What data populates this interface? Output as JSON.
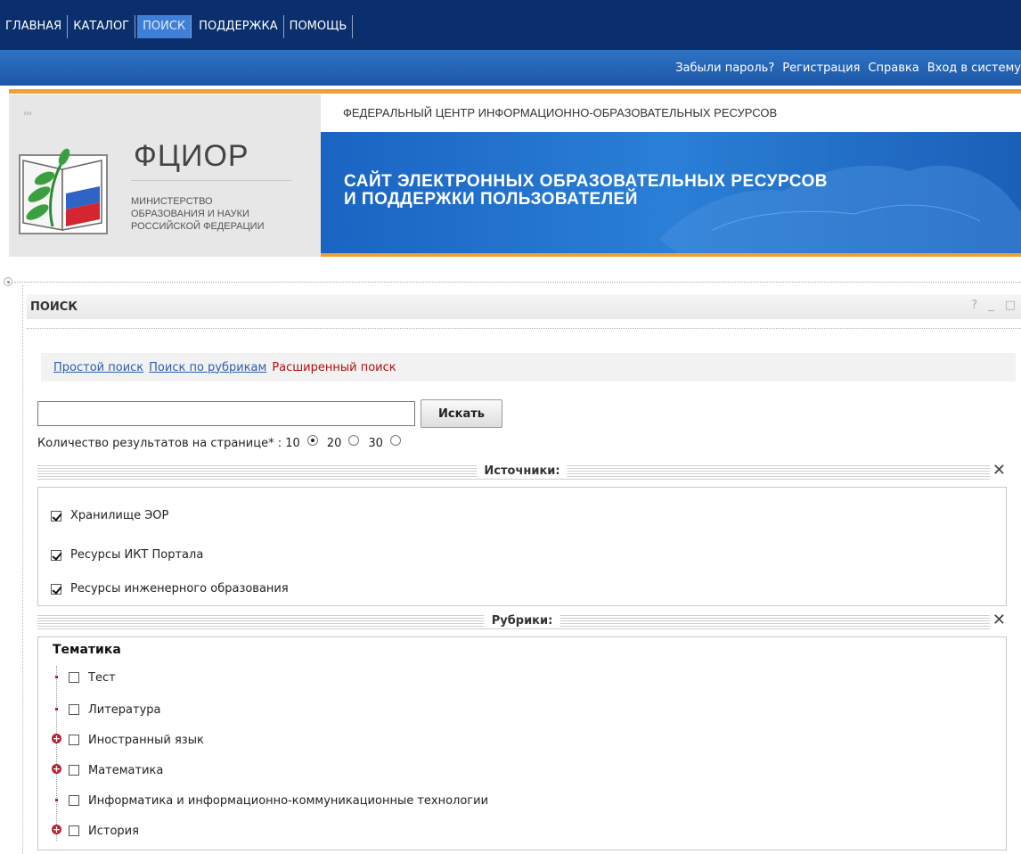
{
  "topnav": {
    "items": [
      {
        "label": "ГЛАВНАЯ"
      },
      {
        "label": "КАТАЛОГ"
      },
      {
        "label": "ПОИСК"
      },
      {
        "label": "ПОДДЕРЖКА"
      },
      {
        "label": "ПОМОЩЬ"
      }
    ],
    "active_index": 2
  },
  "toolbar": {
    "forgot": "Забыли пароль?",
    "register": "Регистрация",
    "help": "Справка",
    "login": "Вход в систему"
  },
  "header": {
    "arrows": "›››",
    "center_title": "ФЕДЕРАЛЬНЫЙ ЦЕНТР ИНФОРМАЦИОННО-ОБРАЗОВАТЕЛЬНЫХ РЕСУРСОВ",
    "brand": "ФЦИОР",
    "ministry_line1": "МИНИСТЕРСТВО",
    "ministry_line2": "ОБРАЗОВАНИЯ И НАУКИ",
    "ministry_line3": "РОССИЙСКОЙ ФЕДЕРАЦИИ",
    "banner_line1": "САЙТ ЭЛЕКТРОННЫХ ОБРАЗОВАТЕЛЬНЫХ РЕСУРСОВ",
    "banner_line2": "И ПОДДЕРЖКИ ПОЛЬЗОВАТЕЛЕЙ"
  },
  "portlet": {
    "title": "ПОИСК",
    "help": "?",
    "minimize": "_",
    "maximize": "□"
  },
  "search": {
    "modes": {
      "simple": "Простой поиск",
      "rubrics": "Поиск по рубрикам",
      "advanced": "Расширенный поиск"
    },
    "query": "",
    "button": "Искать",
    "rpp_label": "Количество результатов на странице",
    "rpp_suffix": "* : ",
    "rpp_options": [
      "10",
      "20",
      "30"
    ],
    "rpp_selected": "10"
  },
  "sources": {
    "title": "Источники:",
    "close": "✕",
    "items": [
      {
        "label": "Хранилище ЭОР",
        "checked": true
      },
      {
        "label": "Ресурсы ИКТ Портала",
        "checked": true
      },
      {
        "label": "Ресурсы инженерного образования",
        "checked": true
      }
    ]
  },
  "rubrics": {
    "title": "Рубрики:",
    "close": "✕",
    "group": "Тематика",
    "items": [
      {
        "label": "Тест",
        "expandable": false
      },
      {
        "label": "Литература",
        "expandable": false
      },
      {
        "label": "Иностранный язык",
        "expandable": true
      },
      {
        "label": "Математика",
        "expandable": true
      },
      {
        "label": "Информатика и информационно-коммуникационные технологии",
        "expandable": false
      },
      {
        "label": "История",
        "expandable": true
      }
    ]
  },
  "colors": {
    "nav_bg": "#0b2f6c",
    "toolbar_bg": "#1f5fb0",
    "accent_orange": "#f0a030",
    "link_blue": "#2b5fb0",
    "current_red": "#b01010"
  }
}
